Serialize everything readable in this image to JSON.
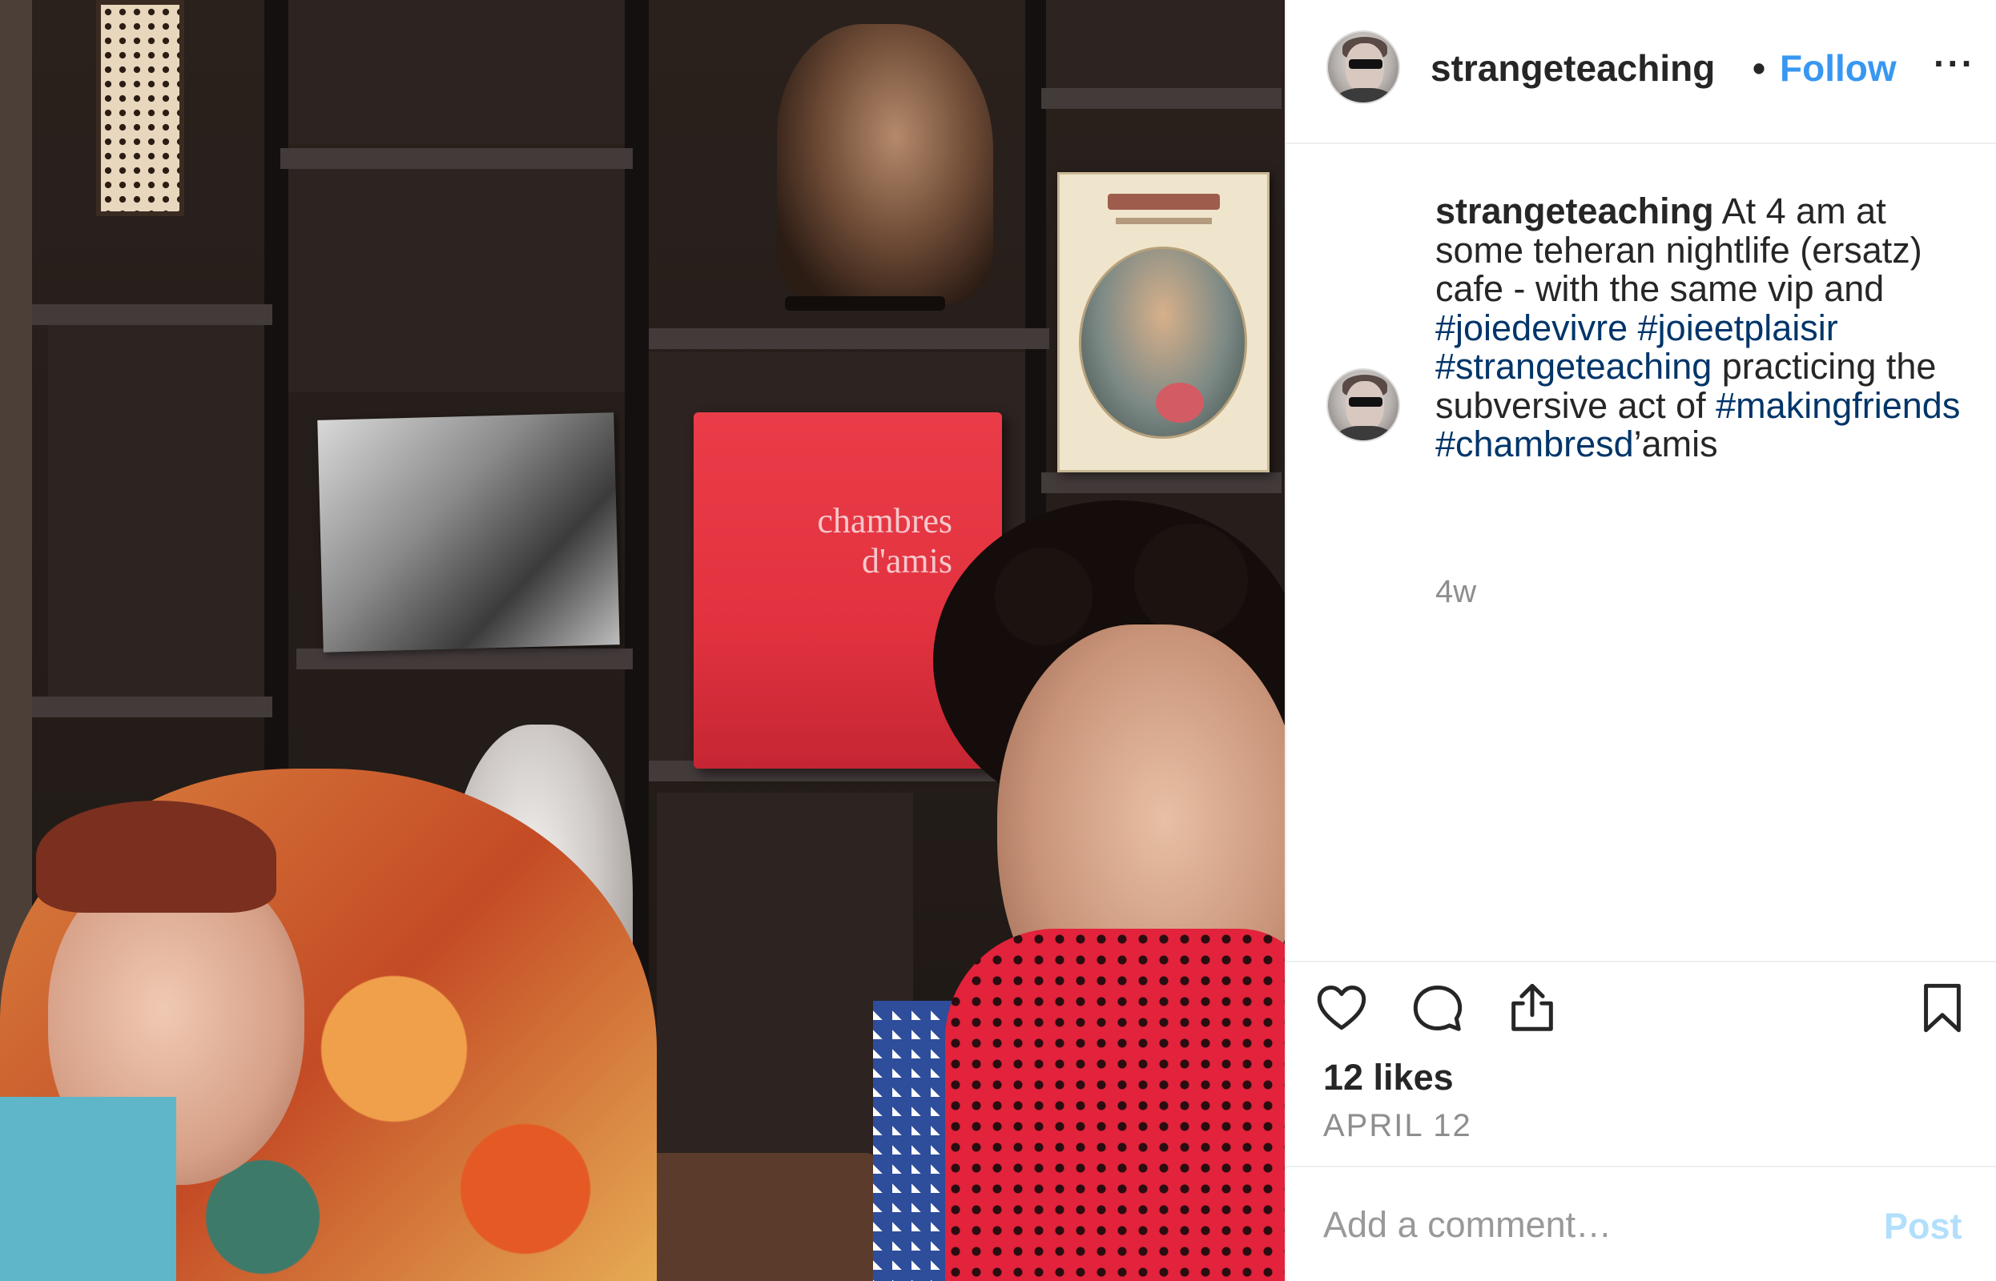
{
  "photo": {
    "record_label_line1": "chambres",
    "record_label_line2": "d'amis"
  },
  "header": {
    "username": "strangeteaching",
    "separator": "•",
    "follow_label": "Follow",
    "more_label": "···",
    "avatar_icon": "profile-avatar"
  },
  "caption": {
    "username": "strangeteaching",
    "text_1": " At 4 am at some teheran nightlife (ersatz) cafe - with the same vip and ",
    "tag_1": "#joiedevivre",
    "tag_2": "#joieetplaisir",
    "tag_3": "#strangeteaching",
    "text_2": " practicing the subversive act of ",
    "tag_4": "#makingfriends",
    "tag_5": "#chambresd",
    "text_3": "’amis",
    "age": "4w"
  },
  "actions": {
    "icons": [
      "heart-icon",
      "comment-icon",
      "share-icon",
      "bookmark-icon"
    ],
    "likes": "12 likes",
    "date": "APRIL 12"
  },
  "comment_box": {
    "placeholder": "Add a comment…",
    "post_label": "Post"
  },
  "colors": {
    "link_blue": "#3897f0",
    "hashtag": "#003569",
    "muted": "#8e8e8e",
    "post_disabled": "#b2dffc",
    "border": "#efefef"
  }
}
